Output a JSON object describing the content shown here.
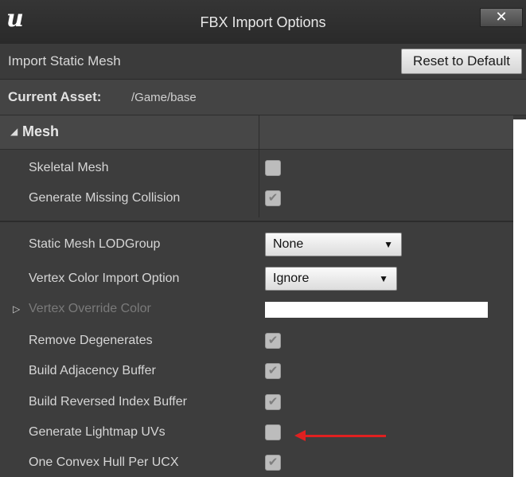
{
  "window": {
    "title": "FBX Import Options",
    "logo_text": "u",
    "close_glyph": "✕"
  },
  "import_header": {
    "label": "Import Static Mesh",
    "reset_button": "Reset to Default"
  },
  "asset": {
    "label": "Current Asset:",
    "value": "/Game/base"
  },
  "section": {
    "label": "Mesh",
    "arrow": "◢"
  },
  "rows": [
    {
      "label": "Skeletal Mesh",
      "type": "checkbox",
      "checked": false
    },
    {
      "label": "Generate Missing Collision",
      "type": "checkbox",
      "checked": true
    },
    {
      "label": "Static Mesh LODGroup",
      "type": "dropdown",
      "value": "None"
    },
    {
      "label": "Vertex Color Import Option",
      "type": "dropdown",
      "value": "Ignore"
    },
    {
      "label": "Vertex Override Color",
      "type": "color",
      "value": "#ffffff",
      "disabled": true,
      "expand_glyph": "▷"
    },
    {
      "label": "Remove Degenerates",
      "type": "checkbox",
      "checked": true
    },
    {
      "label": "Build Adjacency Buffer",
      "type": "checkbox",
      "checked": true
    },
    {
      "label": "Build Reversed Index Buffer",
      "type": "checkbox",
      "checked": true
    },
    {
      "label": "Generate Lightmap UVs",
      "type": "checkbox",
      "checked": false
    },
    {
      "label": "One Convex Hull Per UCX",
      "type": "checkbox",
      "checked": true
    }
  ],
  "check_glyph": "✔",
  "dropdown_caret": "▼",
  "colors": {
    "annotation_arrow": "#e02020",
    "panel_bg": "#3d3d3d"
  }
}
